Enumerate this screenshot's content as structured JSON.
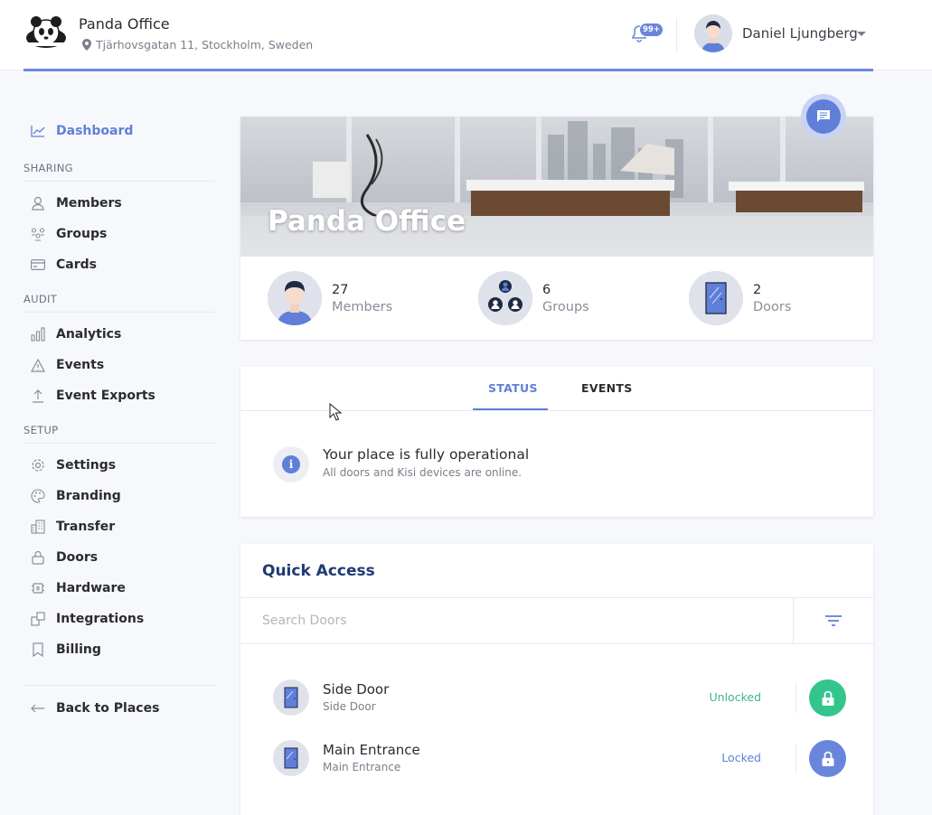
{
  "header": {
    "place_name": "Panda Office",
    "place_address": "Tjärhovsgatan 11, Stockholm, Sweden",
    "notifications_badge": "99+",
    "user_name": "Daniel Ljungberg"
  },
  "sidebar": {
    "dashboard": "Dashboard",
    "sections": {
      "sharing": "SHARING",
      "audit": "AUDIT",
      "setup": "SETUP"
    },
    "sharing_items": [
      "Members",
      "Groups",
      "Cards"
    ],
    "audit_items": [
      "Analytics",
      "Events",
      "Event Exports"
    ],
    "setup_items": [
      "Settings",
      "Branding",
      "Transfer",
      "Doors",
      "Hardware",
      "Integrations",
      "Billing"
    ],
    "back": "Back to Places"
  },
  "hero": {
    "title": "Panda Office",
    "stats": [
      {
        "count": "27",
        "label": "Members"
      },
      {
        "count": "6",
        "label": "Groups"
      },
      {
        "count": "2",
        "label": "Doors"
      }
    ]
  },
  "status_card": {
    "tabs": [
      "STATUS",
      "EVENTS"
    ],
    "active_tab": "STATUS",
    "title": "Your place is fully operational",
    "subtitle": "All doors and Kisi devices are online."
  },
  "quick_access": {
    "title": "Quick Access",
    "search_placeholder": "Search Doors",
    "doors": [
      {
        "name": "Side Door",
        "subtitle": "Side Door",
        "state": "Unlocked",
        "state_color": "#3bb98a",
        "button_color": "#33c58c"
      },
      {
        "name": "Main Entrance",
        "subtitle": "Main Entrance",
        "state": "Locked",
        "state_color": "#5f7fd9",
        "button_color": "#6a86dc"
      }
    ]
  },
  "colors": {
    "accent": "#5f7fd9",
    "title_navy": "#1f3a73",
    "unlocked_green": "#33c58c"
  }
}
